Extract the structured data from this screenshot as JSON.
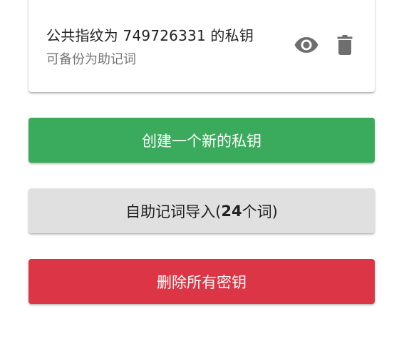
{
  "key_card": {
    "title": "公共指纹为 749726331 的私钥",
    "subtitle": "可备份为助记词",
    "icons": {
      "show": "eye-icon",
      "delete": "trash-icon"
    }
  },
  "buttons": {
    "create": "创建一个新的私钥",
    "import_prefix": "自助记词导入(",
    "import_count": "24",
    "import_suffix": "个词)",
    "delete_all": "删除所有密钥"
  },
  "colors": {
    "create": "#3aab5c",
    "import": "#e0e0e0",
    "delete_all": "#dc3545",
    "icon": "#6e6e6e"
  }
}
